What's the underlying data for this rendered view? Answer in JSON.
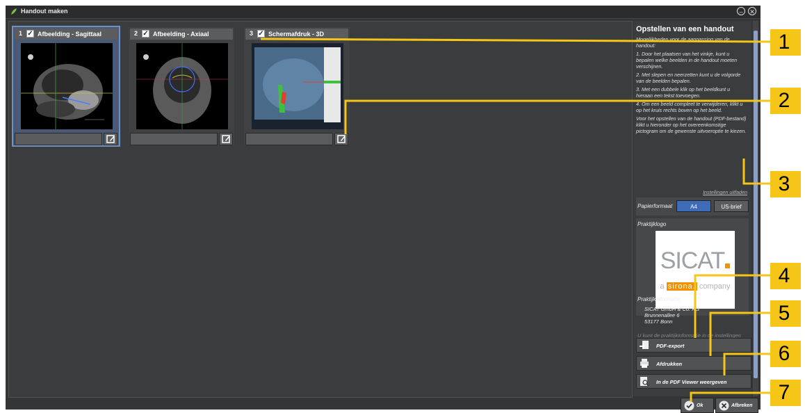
{
  "window": {
    "title": "Handout maken",
    "minimize_symbol": "–",
    "close_symbol": "✕"
  },
  "images": [
    {
      "num": "1",
      "label": "Afbeelding - Sagittaal",
      "selected": true,
      "checked": "✓"
    },
    {
      "num": "2",
      "label": "Afbeelding - Axiaal",
      "selected": false,
      "checked": "✓"
    },
    {
      "num": "3",
      "label": "Schermafdruk - 3D",
      "selected": false,
      "checked": "✓"
    }
  ],
  "panel": {
    "title": "Opstellen van een handout",
    "intro": "Mogelijkheden voor de aanpassing van de handout:",
    "step1": "1. Door het plaatsen van het vinkje, kunt u bepalen welke beelden in de handout moeten verschijnen.",
    "step2": "2. Met slepen en neerzetten kunt u de volgorde van de beelden bepalen.",
    "step3": "3. Met een dubbele klik op het beeldkunt u hieraan een tekst toevoegen.",
    "step4": "4. Om een beeld compleet te verwijderen, klikt u op het kruis rechts boven op het beeld.",
    "pdf_hint": "Voor het opstellen van de handout (PDF-bestand) klikt u hieronder op het overeenkomstige pictogram om de gewenste uitvoeroptie te kiezen.",
    "settings_link": "Instellingen uitfaden",
    "paper_label": "Papierformaat",
    "paper_a4": "A4",
    "paper_us": "US-brief",
    "logo_label": "Praktijklogo",
    "logo_brand": "SICAT",
    "logo_tagline_a": "a",
    "logo_tagline_brand": "sirona.",
    "logo_tagline_rest": "company",
    "info_label": "Praktijkinformatie",
    "info_line1": "SICAT GmbH & Co. KG",
    "info_line2": "Brunnenallee 6",
    "info_line3": "53177 Bonn",
    "info_note": "U kunt de praktijkinformatie in de instellingen aanpassen.",
    "btn_pdf": "PDF-export",
    "btn_print": "Afdrukken",
    "btn_viewer": "In de PDF Viewer weergeven",
    "btn_ok": "Ok",
    "btn_cancel": "Afbreken"
  },
  "callouts": [
    "1",
    "2",
    "3",
    "4",
    "5",
    "6",
    "7"
  ],
  "colors": {
    "accent": "#f5c518",
    "selection": "#4a5a76",
    "logo_orange": "#f39200"
  }
}
